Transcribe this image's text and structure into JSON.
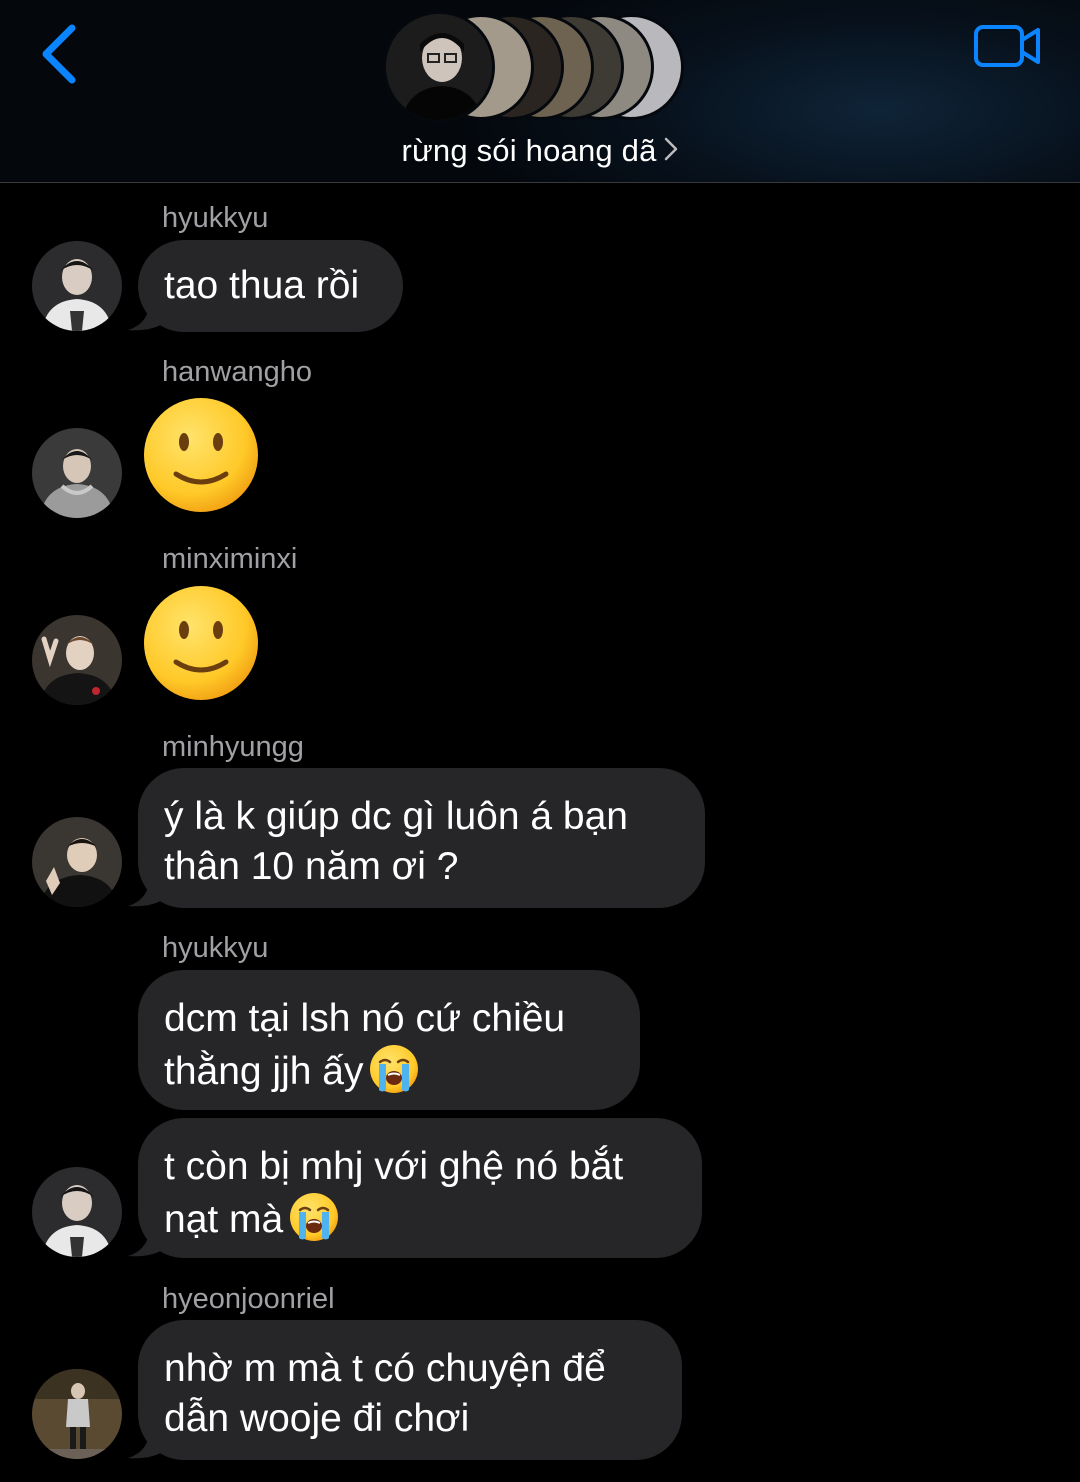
{
  "header": {
    "title": "rừng sói hoang dã",
    "back_icon": "chevron-left-icon",
    "video_icon": "video-camera-icon",
    "accent_color": "#0a84ff"
  },
  "messages": [
    {
      "sender": "hyukkyu",
      "text": "tao thua rồi"
    },
    {
      "sender": "hanwangho",
      "emoji": "slightly-smiling-face"
    },
    {
      "sender": "minximinxi",
      "emoji": "slightly-smiling-face"
    },
    {
      "sender": "minhyungg",
      "line1": "ý là k giúp dc gì luôn á bạn",
      "line2": "thân 10 năm ơi ?"
    },
    {
      "sender": "hyukkyu",
      "line1": "dcm tại lsh nó cứ chiều",
      "line2": "thằng jjh ấy"
    },
    {
      "line1": "t còn bị mhj với ghệ nó bắt",
      "line2": "nạt mà"
    },
    {
      "sender": "hyeonjoonriel",
      "line1": "nhờ m mà t có chuyện để",
      "line2": "dẫn wooje đi chơi"
    }
  ]
}
